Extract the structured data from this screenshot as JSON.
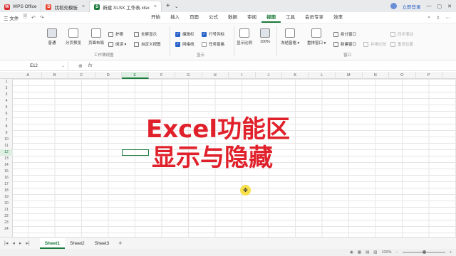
{
  "titlebar": {
    "tabs": [
      {
        "label": "WPS Office",
        "icon": "wps-logo-icon",
        "color": "#d9262c"
      },
      {
        "label": "找稻壳模板",
        "icon": "docer-icon",
        "color": "#e8452f"
      },
      {
        "label": "新建 XLSX 工作表.xlsx",
        "icon": "spreadsheet-icon",
        "color": "#1a7a3a"
      }
    ],
    "login": "立即登录"
  },
  "menubar": {
    "file": "三 文件",
    "tabs": [
      "开始",
      "插入",
      "页面",
      "公式",
      "数据",
      "审阅",
      "视图",
      "工具",
      "会员专享",
      "效率"
    ],
    "active_tab": "视图"
  },
  "ribbon": {
    "normal": "普通",
    "page_break": "分页预览",
    "page_layout": "页面布局",
    "protect": "护眼",
    "reading": "阅读 ▾",
    "full_screen": "全屏显示",
    "custom_view": "自定义视图",
    "group_workbook_view": "工作簿视图",
    "edit_bar": "编辑栏",
    "gridlines": "网格线",
    "row_col_header": "行号列标",
    "task_pane": "任务窗格",
    "group_display": "显示",
    "zoom": "显示比例",
    "zoom_100": "100%",
    "freeze": "冻结窗格 ▾",
    "rearrange": "重排窗口 ▾",
    "split": "拆分窗口",
    "new_window": "新建窗口",
    "side_by_side": "并排比较",
    "sync_scroll": "同步滚动",
    "reset_pos": "重设位置",
    "group_window": "窗口"
  },
  "formula_bar": {
    "cell_ref": "E12",
    "icons": [
      "zoom-icon",
      "fx-icon"
    ]
  },
  "grid": {
    "columns": [
      "A",
      "B",
      "C",
      "D",
      "E",
      "F",
      "G",
      "H",
      "I",
      "J",
      "K",
      "L",
      "M",
      "N",
      "O",
      "P"
    ],
    "rows": [
      "1",
      "2",
      "3",
      "4",
      "5",
      "6",
      "7",
      "8",
      "9",
      "10",
      "11",
      "12",
      "13",
      "14",
      "15",
      "16",
      "17",
      "18",
      "19",
      "20",
      "21",
      "22",
      "23",
      "24"
    ],
    "selected_col": "E",
    "selected_row": "12"
  },
  "overlay": {
    "line1": "Excel功能区",
    "line2": "显示与隐藏"
  },
  "sheets": {
    "tabs": [
      "Sheet1",
      "Sheet2",
      "Sheet3"
    ],
    "active": "Sheet1"
  },
  "status": {
    "zoom": "100%"
  }
}
